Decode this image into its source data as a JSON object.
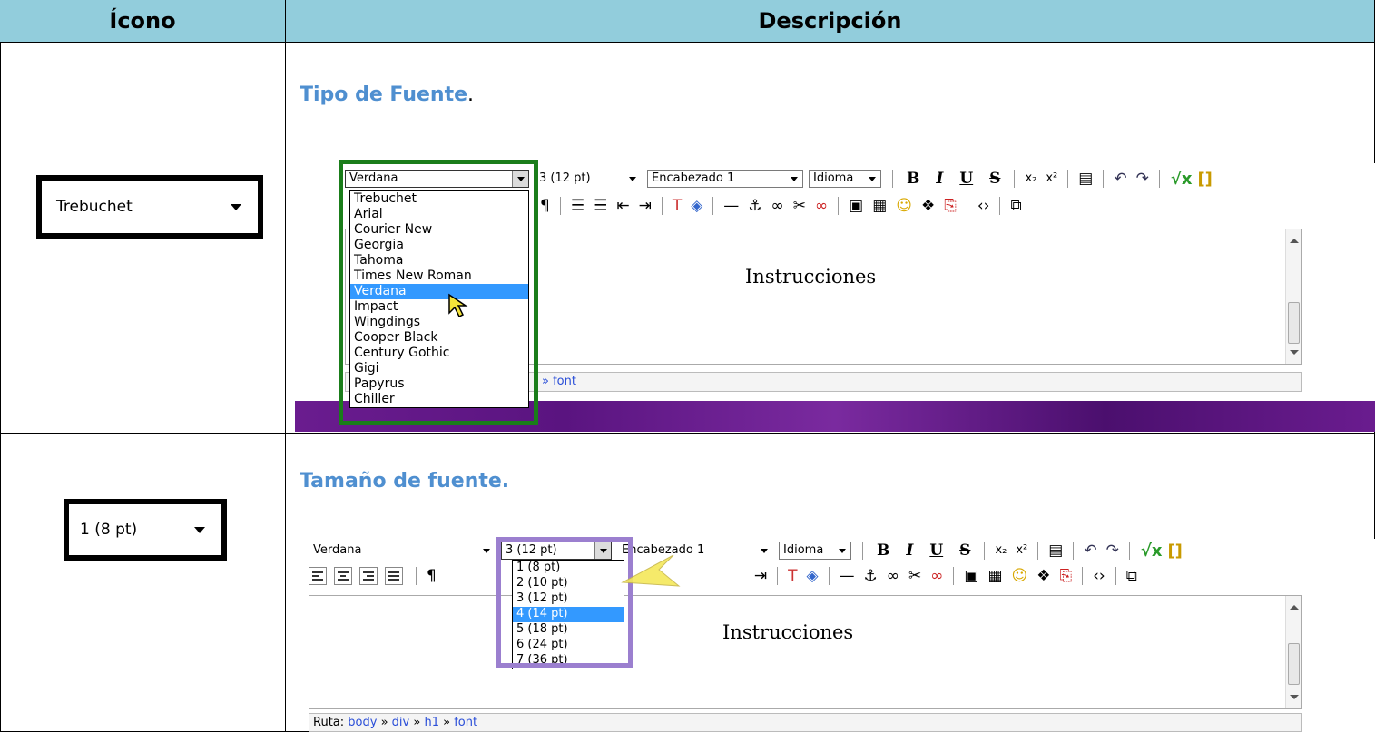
{
  "header": {
    "col1": "Ícono",
    "col2": "Descripción"
  },
  "row1": {
    "title": "Tipo de Fuente",
    "period": ".",
    "sample_value": "Trebuchet",
    "editor": {
      "font_select": "Verdana",
      "size_select": "3 (12 pt)",
      "format_select": "Encabezado 1",
      "lang_select": "Idioma",
      "doc_text": "Instrucciones",
      "path_tail": "» font",
      "list": [
        "Trebuchet",
        "Arial",
        "Courier New",
        "Georgia",
        "Tahoma",
        "Times New Roman",
        "Verdana",
        "Impact",
        "Wingdings",
        "Cooper Black",
        "Century Gothic",
        "Gigi",
        "Papyrus",
        "Chiller"
      ],
      "selected": "Verdana"
    }
  },
  "row2": {
    "title": "Tamaño de fuente.",
    "sample_value": "1 (8 pt)",
    "editor": {
      "font_select": "Verdana",
      "size_select": "3 (12 pt)",
      "format_select": "Encabezado 1",
      "lang_select": "Idioma",
      "doc_text": "Instrucciones",
      "path_label": "Ruta:",
      "path": [
        "body",
        "»",
        "div",
        "»",
        "h1",
        "»",
        "font"
      ],
      "list": [
        "1 (8 pt)",
        "2 (10 pt)",
        "3 (12 pt)",
        "4 (14 pt)",
        "5 (18 pt)",
        "6 (24 pt)",
        "7 (36 pt)"
      ],
      "selected": "4 (14 pt)"
    }
  },
  "toolbar": {
    "bold": "B",
    "italic": "I",
    "underline": "U",
    "strike": "S",
    "sub": "x₂",
    "sup": "x²"
  },
  "colors": {
    "header_bg": "#92cddc",
    "title_color": "#4f8fd0",
    "frame1": "#1a7d1a",
    "frame2": "#9b7fcf",
    "highlight": "#3399ff"
  }
}
